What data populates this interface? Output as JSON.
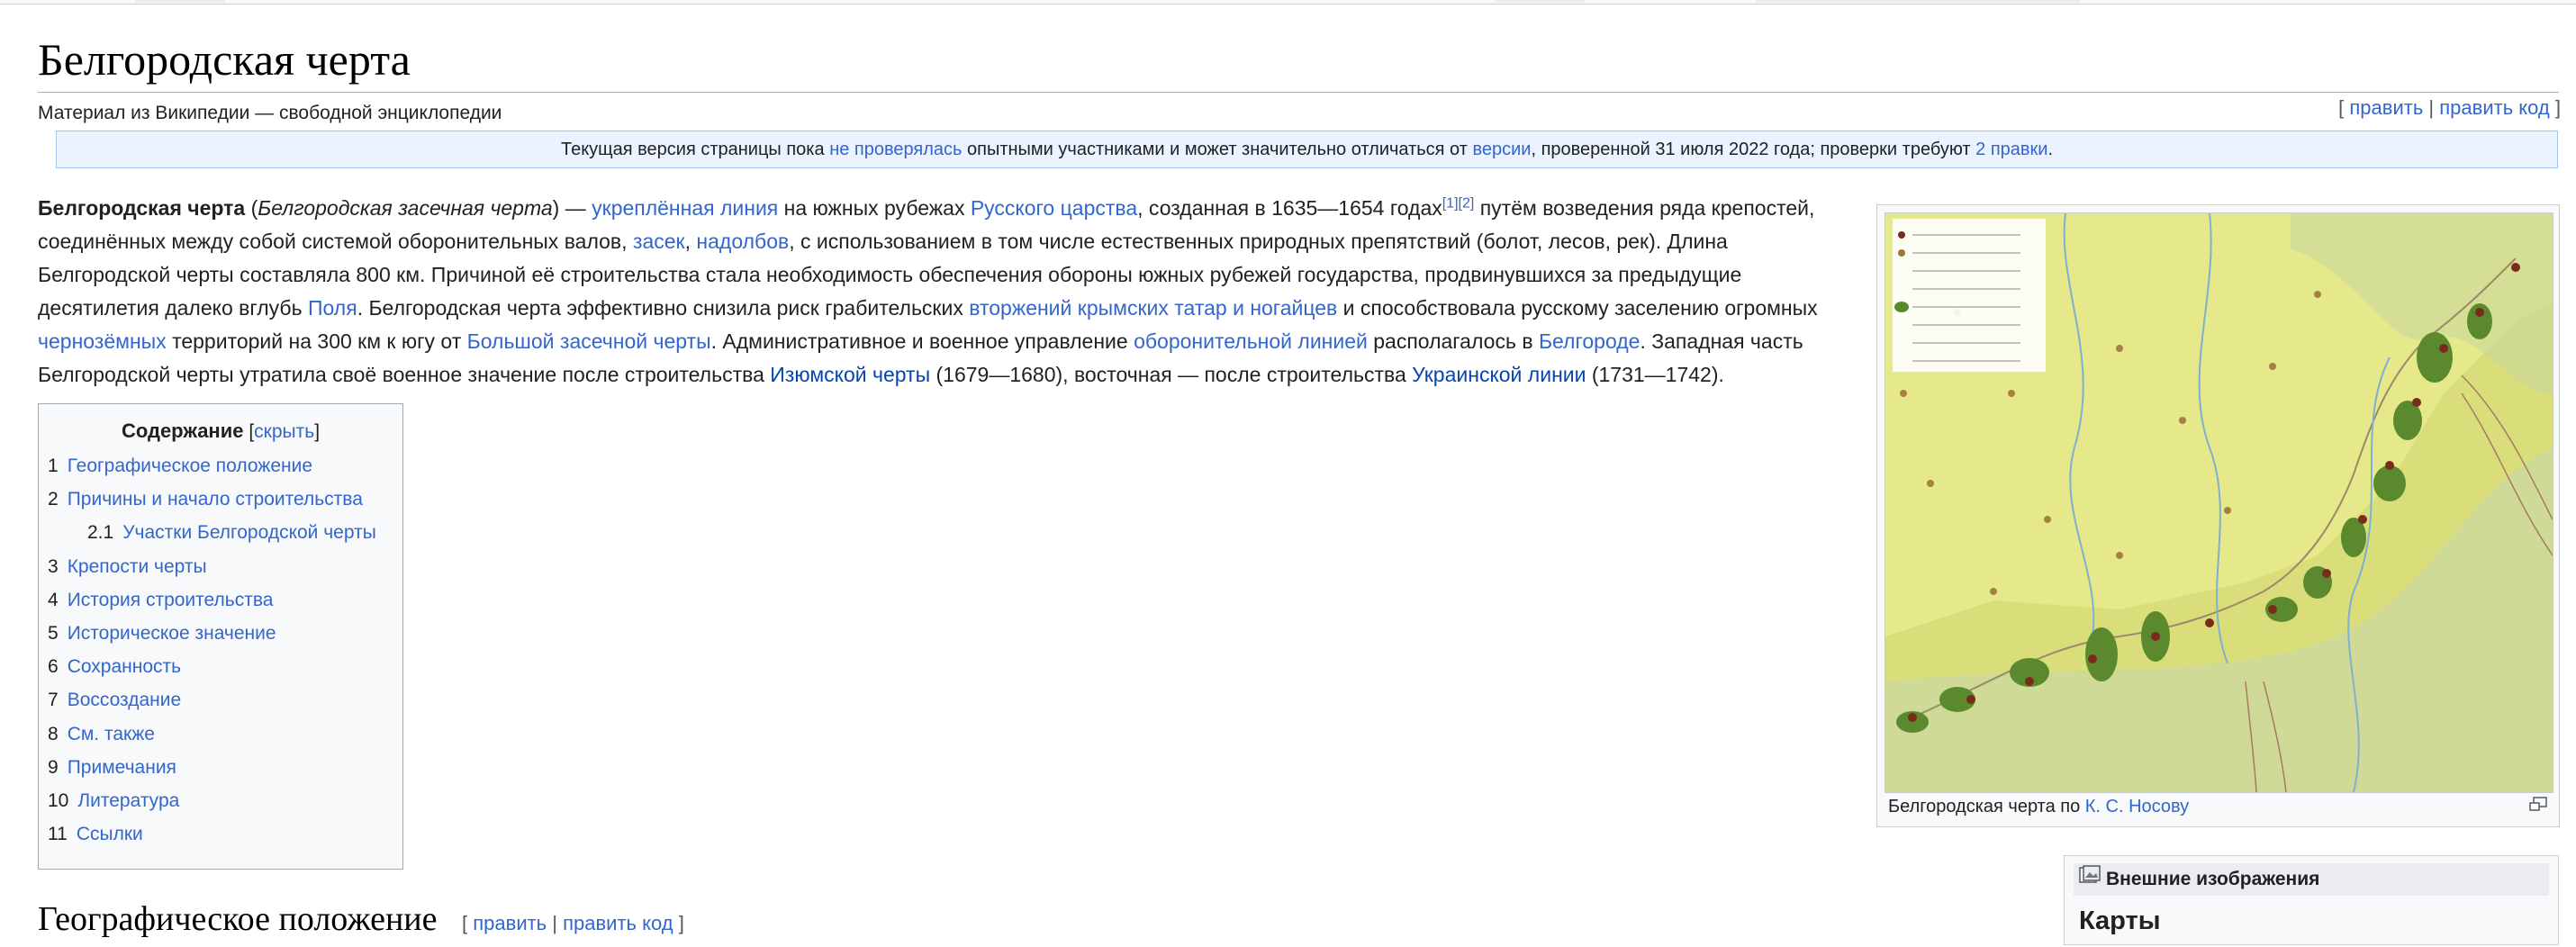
{
  "page": {
    "title": "Белгородская черта",
    "tagline": "Материал из Википедии — свободной энциклопедии",
    "edit": "править",
    "edit_source": "править код"
  },
  "flagged": {
    "prefix": "Текущая версия страницы пока ",
    "link1": "не проверялась",
    "middle": " опытными участниками и может значительно отличаться от ",
    "link2": "версии",
    "after": ", проверенной 31 июля 2022 года; проверки требуют ",
    "link3": "2 правки",
    "end": "."
  },
  "lead": {
    "t1": "Белгородская черта",
    "t2": " (",
    "t3": "Белгородская засечная черта",
    "t4": ") — ",
    "l1": "укреплённая линия",
    "t5": " на южных рубежах ",
    "l2": "Русского царства",
    "t6": ", созданная в 1635—1654 годах",
    "ref1": "[1]",
    "ref2": "[2]",
    "t7": " путём возведения ряда крепостей, соединённых между собой системой оборонительных валов, ",
    "l3": "засек",
    "t8": ", ",
    "l4": "надолбов",
    "t9": ", с использованием в том числе естественных природных препятствий (болот, лесов, рек). Длина Белгородской черты составляла 800 км. Причиной её строительства стала необходимость обеспечения обороны южных рубежей государства, продвинувшихся за предыдущие десятилетия далеко вглубь ",
    "l5": "Поля",
    "t10": ". Белгородская черта эффективно снизила риск грабительских ",
    "l6": "вторжений крымских татар и ногайцев",
    "t11": " и способствовала русскому заселению огромных ",
    "l7": "чернозёмных",
    "t12": " территорий на 300 км к югу от ",
    "l8": "Большой засечной черты",
    "t13": ". Административное и военное управление ",
    "l9": "оборонительной линией",
    "t14": " располагалось в ",
    "l10": "Белгороде",
    "t15": ". Западная часть Белгородской черты утратила своё военное значение после строительства ",
    "l11": "Изюмской черты",
    "t16": " (1679—1680), восточная — после строительства ",
    "l12": "Украинской линии",
    "t17": " (1731—1742)."
  },
  "toc": {
    "title": "Содержание",
    "hide": "скрыть",
    "items": [
      {
        "num": "1",
        "label": "Географическое положение"
      },
      {
        "num": "2",
        "label": "Причины и начало строительства"
      },
      {
        "num": "2.1",
        "label": "Участки Белгородской черты"
      },
      {
        "num": "3",
        "label": "Крепости черты"
      },
      {
        "num": "4",
        "label": "История строительства"
      },
      {
        "num": "5",
        "label": "Историческое значение"
      },
      {
        "num": "6",
        "label": "Сохранность"
      },
      {
        "num": "7",
        "label": "Воссоздание"
      },
      {
        "num": "8",
        "label": "См. также"
      },
      {
        "num": "9",
        "label": "Примечания"
      },
      {
        "num": "10",
        "label": "Литература"
      },
      {
        "num": "11",
        "label": "Ссылки"
      }
    ]
  },
  "thumb": {
    "caption_prefix": "Белгородская черта по ",
    "caption_link": "К. С. Носову",
    "icon": "magnify-clip-icon"
  },
  "external": {
    "header": "Внешние изображения",
    "subheader": "Карты",
    "icon": "image-icon"
  },
  "section": {
    "title": "Географическое положение"
  },
  "colors": {
    "link": "#3366cc",
    "flagged_bg": "#eaf3ff",
    "map_yellow": "#e6e98a",
    "map_green": "#5b8a2e"
  }
}
